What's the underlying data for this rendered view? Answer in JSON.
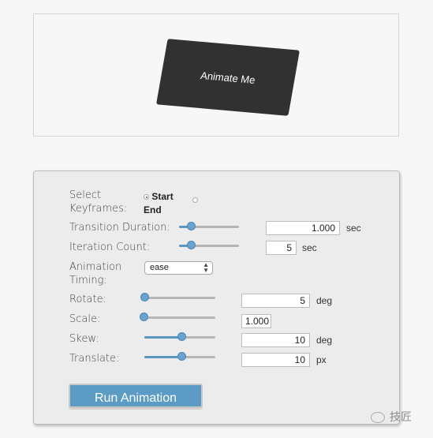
{
  "preview": {
    "box_label": "Animate Me"
  },
  "panel": {
    "keyframes": {
      "label_line1": "Select",
      "label_line2": "Keyframes:",
      "options": [
        {
          "label": "Start",
          "checked": true
        },
        {
          "label": "End",
          "checked": false
        }
      ]
    },
    "transition_duration": {
      "label": "Transition Duration:",
      "value": "1.000",
      "unit": "sec",
      "slider_fraction": 0.2
    },
    "iteration_count": {
      "label": "Iteration Count:",
      "value": "5",
      "unit": "sec",
      "slider_fraction": 0.2
    },
    "timing": {
      "label_line1": "Animation",
      "label_line2": "Timing:",
      "selected": "ease"
    },
    "rotate": {
      "label": "Rotate:",
      "value": "5",
      "unit": "deg",
      "slider_fraction": 0.0
    },
    "scale": {
      "label": "Scale:",
      "value": "1.000",
      "unit": "",
      "slider_fraction": 0.0
    },
    "skew": {
      "label": "Skew:",
      "value": "10",
      "unit": "deg",
      "slider_fraction": 0.52
    },
    "translate": {
      "label": "Translate:",
      "value": "10",
      "unit": "px",
      "slider_fraction": 0.52
    },
    "run_button": "Run Animation"
  },
  "watermark": {
    "text": "技匠",
    "icon": "wechat-icon"
  }
}
